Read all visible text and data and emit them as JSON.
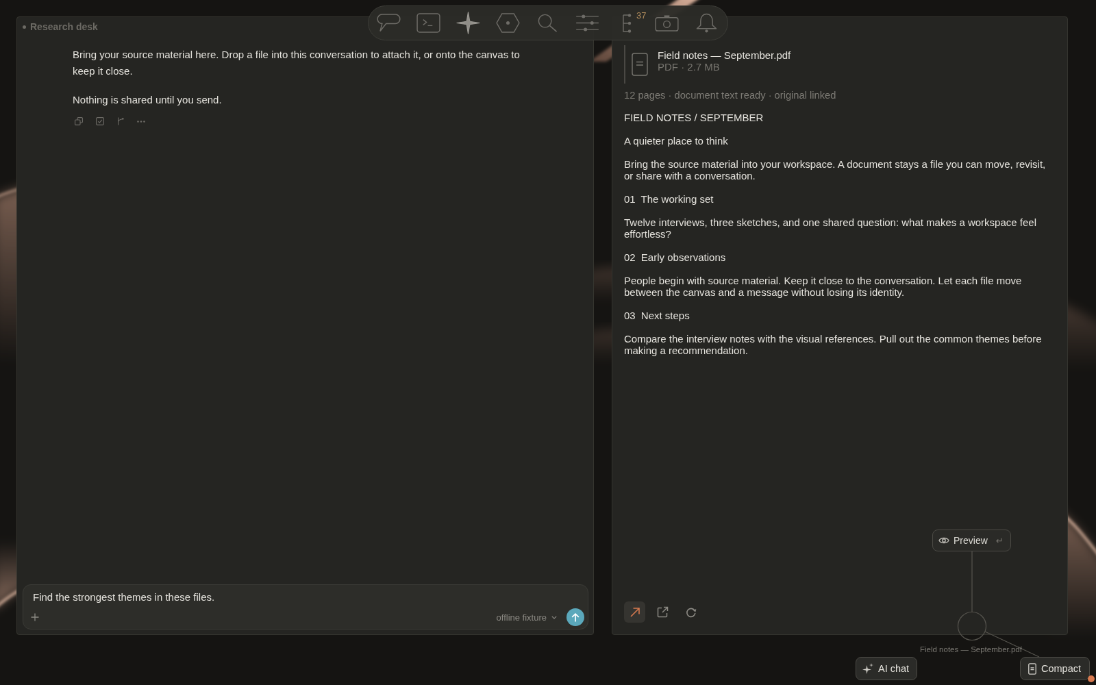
{
  "toolbar": {
    "items": [
      {
        "selected": false
      },
      {
        "selected": false
      },
      {
        "selected": true
      },
      {
        "selected": false
      },
      {
        "selected": false
      },
      {
        "selected": false
      },
      {
        "selected": false,
        "badge": "37"
      },
      {
        "selected": false
      },
      {
        "selected": false
      }
    ]
  },
  "chat_panel": {
    "title": "Research desk",
    "messages": [
      {
        "paragraphs": [
          "Bring your source material here. Drop a file into this conversation to attach it, or onto the canvas to keep it close.",
          "Nothing is shared until you send."
        ]
      }
    ],
    "composer": {
      "value": "Find the strongest themes in these files.",
      "model": "offline fixture"
    }
  },
  "document_panel": {
    "attachment": {
      "name": "Field notes — September.pdf",
      "meta": "PDF · 2.7 MB"
    },
    "status": "12 pages · document text ready · original linked",
    "blocks": [
      {
        "kind": "text",
        "text": "FIELD NOTES / SEPTEMBER"
      },
      {
        "kind": "text",
        "text": "A quieter place to think"
      },
      {
        "kind": "text",
        "text": "Bring the source material into your workspace. A document stays a file you can move, revisit, or share with a conversation."
      },
      {
        "kind": "section",
        "number": "01",
        "title": "The working set"
      },
      {
        "kind": "text",
        "text": "Twelve interviews, three sketches, and one shared question: what makes a workspace feel effortless?"
      },
      {
        "kind": "section",
        "number": "02",
        "title": "Early observations"
      },
      {
        "kind": "text",
        "text": "People begin with source material. Keep it close to the conversation. Let each file move between the canvas and a message without losing its identity."
      },
      {
        "kind": "section",
        "number": "03",
        "title": "Next steps"
      },
      {
        "kind": "text",
        "text": "Compare the interview notes with the visual references. Pull out the common themes before making a recommendation."
      }
    ],
    "actions": [
      {
        "selected": true
      },
      {
        "selected": false
      },
      {
        "selected": false
      }
    ]
  },
  "canvas": {
    "preview": {
      "label": "Preview",
      "shortcut": "↵"
    },
    "node_caption": "Field notes — September.pdf",
    "buttons": [
      {
        "label": "AI chat"
      },
      {
        "label": "Compact"
      }
    ]
  }
}
